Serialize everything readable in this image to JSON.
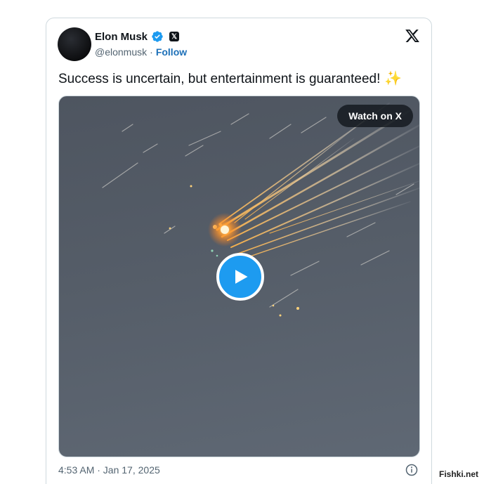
{
  "author": {
    "name": "Elon Musk",
    "handle": "@elonmusk",
    "separator": "·",
    "follow_label": "Follow",
    "verified_icon": "verified-badge-icon",
    "affiliation_icon": "x-affiliate-icon"
  },
  "tweet": {
    "text": "Success is uncertain, but entertainment is guaranteed!",
    "emoji": "✨"
  },
  "media": {
    "watch_label": "Watch on X",
    "play_icon": "play-icon"
  },
  "footer": {
    "timestamp": "4:53 AM · Jan 17, 2025",
    "info_icon": "info-icon"
  },
  "watermark": "Fishki.net",
  "colors": {
    "accent": "#1d9bf0",
    "follow": "#1d70b8",
    "text": "#0f1419",
    "muted": "#536471",
    "border": "#cfd9de"
  }
}
